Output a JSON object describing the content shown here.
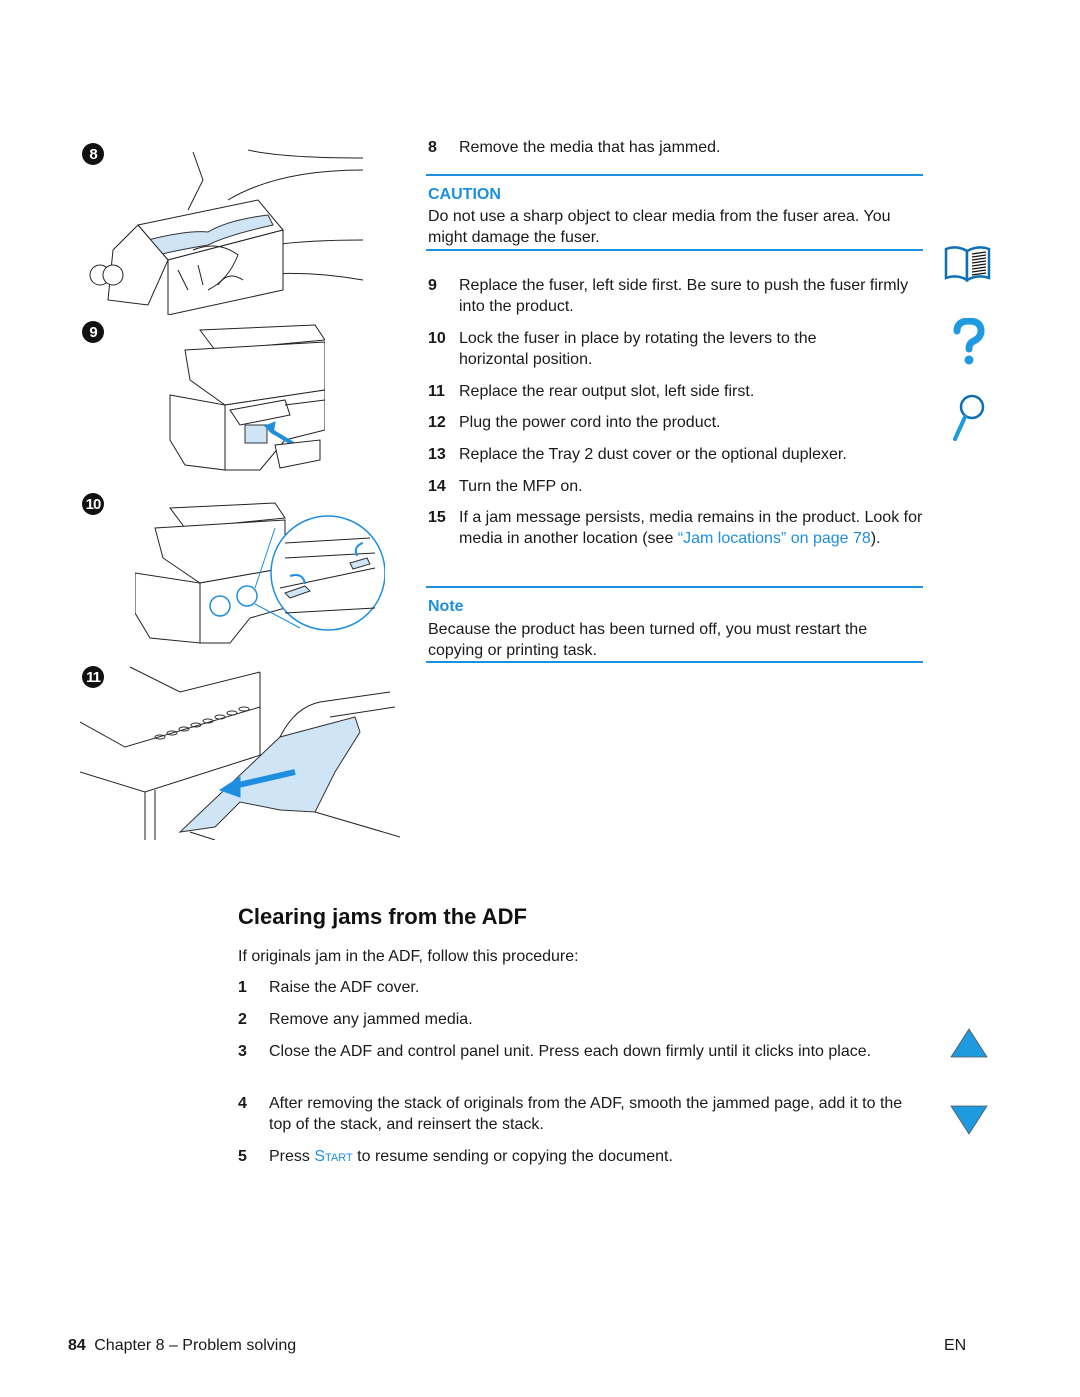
{
  "figure_badges": [
    "8",
    "9",
    "10",
    "11"
  ],
  "steps_top": [
    {
      "num": "8",
      "text": "Remove the media that has jammed."
    },
    {
      "num": "9",
      "text": "Replace the fuser, left side first. Be sure to push the fuser firmly into the product."
    },
    {
      "num": "10",
      "text": "Lock the fuser in place by rotating the levers to the horizontal position."
    },
    {
      "num": "11",
      "text": "Replace the rear output slot, left side first."
    },
    {
      "num": "12",
      "text": "Plug the power cord into the product."
    },
    {
      "num": "13",
      "text": "Replace the Tray 2 dust cover or the optional duplexer."
    },
    {
      "num": "14",
      "text": "Turn the MFP on."
    },
    {
      "num": "15",
      "text_before": "If a jam message persists, media remains in the product. Look for media in another location (see ",
      "link": "“Jam locations” on page 78",
      "text_after": ")."
    }
  ],
  "caution": {
    "label": "CAUTION",
    "text": "Do not use a sharp object to clear media from the fuser area. You might damage the fuser."
  },
  "note": {
    "label": "Note",
    "text": "Because the product has been turned off, you must restart the copying or printing task."
  },
  "section": {
    "title": "Clearing jams from the ADF",
    "intro": "If originals jam in the ADF, follow this procedure:",
    "steps": [
      {
        "num": "1",
        "text": "Raise the ADF cover."
      },
      {
        "num": "2",
        "text": "Remove any jammed media."
      },
      {
        "num": "3",
        "text": "Close the ADF and control panel unit. Press each down firmly until it clicks into place."
      },
      {
        "num": "4",
        "text": "After removing the stack of originals from the ADF, smooth the jammed page, add it to the top of the stack, and reinsert the stack."
      },
      {
        "num": "5",
        "text_before": "Press ",
        "key": "Start",
        "text_after": " to resume sending or copying the document."
      }
    ]
  },
  "side_icons": [
    "book-icon",
    "help-question-icon",
    "search-magnifier-icon",
    "previous-page-icon",
    "next-page-icon"
  ],
  "footer": {
    "page_number": "84",
    "chapter": "Chapter 8 – Problem solving",
    "lang": "EN"
  },
  "colors": {
    "accent": "#1e8fe0",
    "illustration_fill": "#cfe4f5"
  }
}
